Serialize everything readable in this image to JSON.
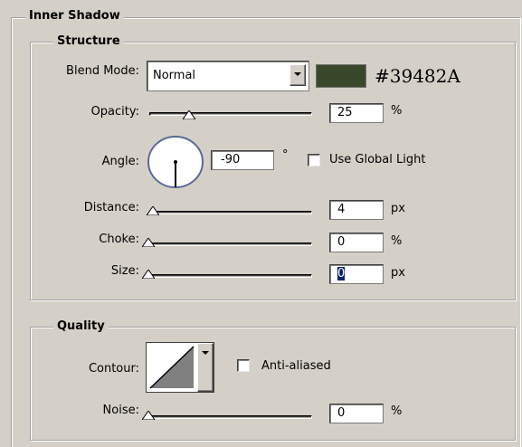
{
  "inner_shadow": {
    "title": "Inner Shadow"
  },
  "structure": {
    "title": "Structure",
    "blend_mode_label": "Blend Mode:",
    "blend_mode_value": "Normal",
    "color_hex": "#39482A",
    "color_swatch": "#39482A",
    "opacity_label": "Opacity:",
    "opacity_value": "25",
    "opacity_unit": "%",
    "opacity_fraction": 0.25,
    "angle_label": "Angle:",
    "angle_value": "-90",
    "angle_unit": "°",
    "use_global_light_label": "Use Global Light",
    "use_global_light_checked": false,
    "distance_label": "Distance:",
    "distance_value": "4",
    "distance_unit": "px",
    "choke_label": "Choke:",
    "choke_value": "0",
    "choke_unit": "%",
    "size_label": "Size:",
    "size_value": "0",
    "size_unit": "px"
  },
  "quality": {
    "title": "Quality",
    "contour_label": "Contour:",
    "anti_aliased_label": "Anti-aliased",
    "anti_aliased_checked": false,
    "noise_label": "Noise:",
    "noise_value": "0",
    "noise_unit": "%"
  }
}
